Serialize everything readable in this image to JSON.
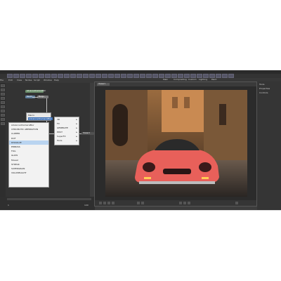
{
  "menubar": {
    "items": [
      "File",
      "Edit",
      "View",
      "Nodes",
      "Script",
      "Window",
      "Help",
      "Tab",
      "Tab",
      "Tab",
      "Tab",
      "Tab",
      "Tab",
      "Tab",
      "Tab",
      "Tab",
      "Tab",
      "Tab",
      "Tab",
      "Tab",
      "Tab",
      "Tab",
      "Tab"
    ]
  },
  "viewer": {
    "tab_label": "Viewer1",
    "top_labels": [
      "Main",
      "Compositing",
      "Custom",
      "Lighting",
      "Paint"
    ],
    "image_description_icon": "photo-scene"
  },
  "nodegraph": {
    "nodes": [
      "AdvancedCameraBlur",
      "Read1",
      "Merge",
      "Viewer1"
    ]
  },
  "context_menu": {
    "header": "Macro",
    "header_value": "AdvancedCameraBlur",
    "items": [
      "AdvancedCameraBlur",
      "CHROMATIC ABERRATION",
      "CLIPPER",
      "DOF",
      "DISSOLVE",
      "EMBOSS",
      "FOG",
      "GLOW",
      "Mosaic",
      "STREAK",
      "SUPERGRAIN",
      "VOLUMELIGHT"
    ],
    "highlighted": "DISSOLVE"
  },
  "submenu": {
    "items": [
      "3D",
      "FX",
      "GENERATE",
      "POST",
      "SuperFX",
      "Tools"
    ]
  },
  "timeline": {
    "start": "1",
    "end": "100"
  },
  "rightpanel": {
    "labels": [
      "Tools",
      "Properties",
      "Controls"
    ]
  },
  "colors": {
    "app_bg": "#3d3d3d",
    "menu_bg": "#f2f2f2",
    "highlight": "#b9d4f0",
    "car": "#e8605a"
  }
}
